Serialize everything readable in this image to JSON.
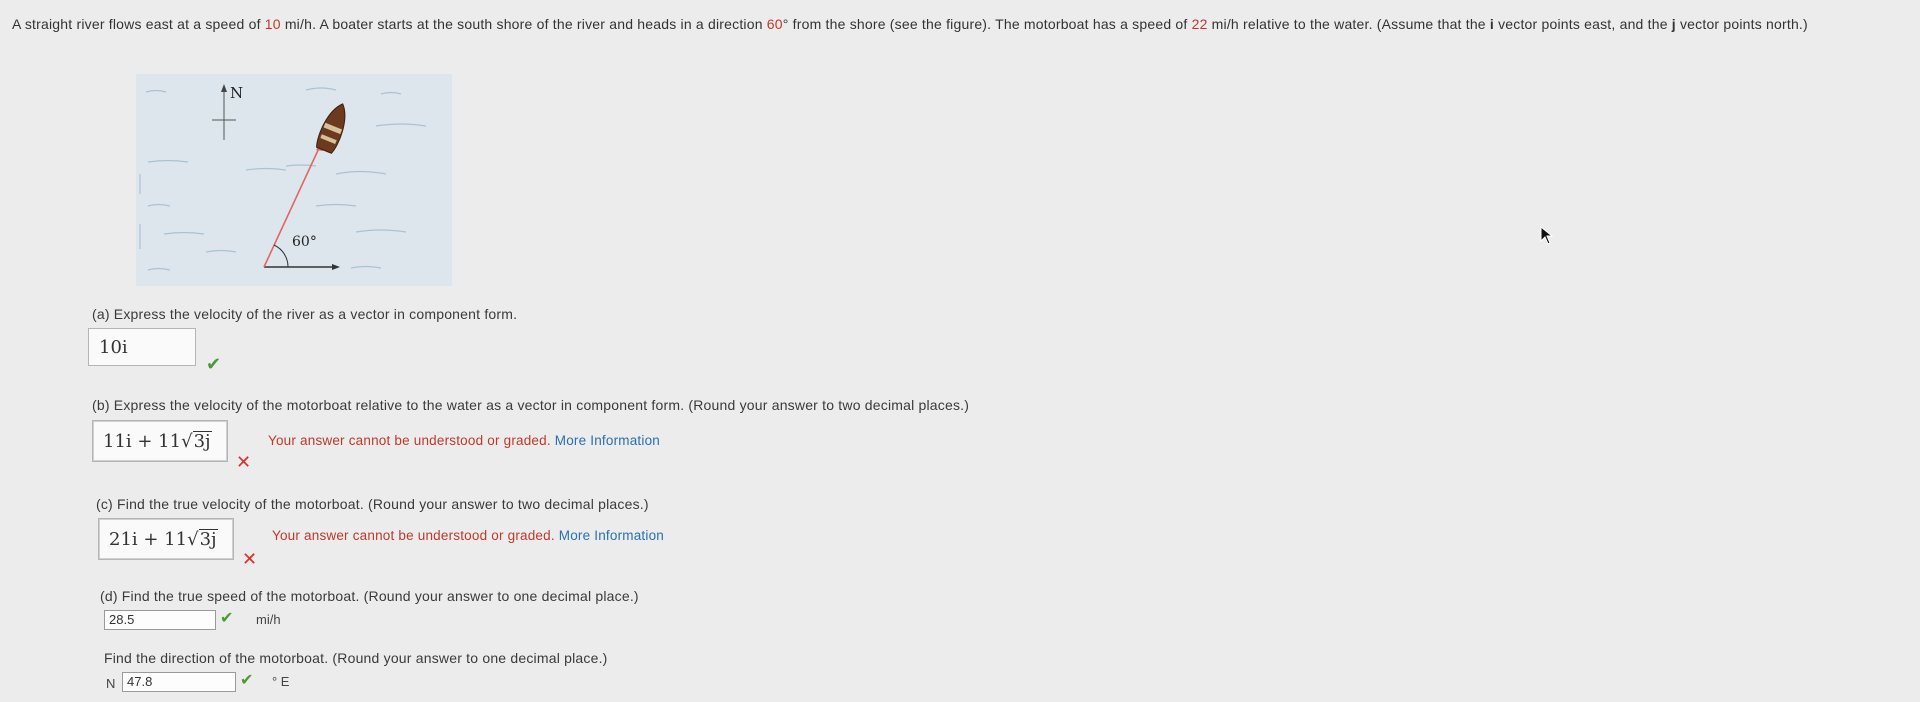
{
  "problem": {
    "t1": "A straight river flows east at a speed of ",
    "river_speed": "10",
    "t2": " mi/h. A boater starts at the south shore of the river and heads in a direction ",
    "angle": "60",
    "t3": "° from the shore (see the figure). The motorboat has a speed of ",
    "boat_speed": "22",
    "t4": " mi/h relative to the water. (Assume that the ",
    "i": "i",
    "t5": " vector points east, and the ",
    "j": "j",
    "t6": " vector points north.)"
  },
  "figure": {
    "north_label": "N",
    "angle_label": "60°"
  },
  "part_a": {
    "question": "(a) Express the velocity of the river as a vector in component form.",
    "answer": "10i"
  },
  "part_b": {
    "question": "(b) Express the velocity of the motorboat relative to the water as a vector in component form. (Round your answer to two decimal places.)",
    "answer_prefix": "11i + 11",
    "answer_radicand": "3j",
    "error": "Your answer cannot be understood or graded.",
    "more": "More Information"
  },
  "part_c": {
    "question": "(c) Find the true velocity of the motorboat. (Round your answer to two decimal places.)",
    "answer_prefix": "21i + 11",
    "answer_radicand": "3j",
    "error": "Your answer cannot be understood or graded.",
    "more": "More Information"
  },
  "part_d": {
    "question": "(d) Find the true speed of the motorboat. (Round your answer to one decimal place.)",
    "answer": "28.5",
    "unit": "mi/h"
  },
  "part_e": {
    "question": "Find the direction of the motorboat. (Round your answer to one decimal place.)",
    "prefix": "N",
    "answer": "47.8",
    "unit": "° E"
  },
  "icons": {
    "correct": "check-icon",
    "incorrect": "cross-icon",
    "cursor": "cursor-icon"
  },
  "colors": {
    "correct": "#4a9a38",
    "incorrect": "#d9302c",
    "error_text": "#c0392b",
    "link": "#2a6fb0"
  }
}
